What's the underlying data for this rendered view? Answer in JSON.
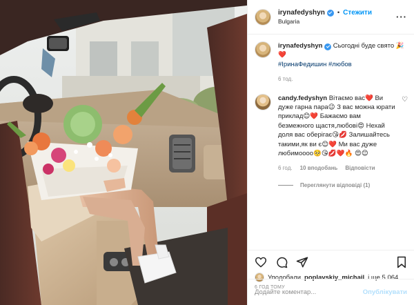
{
  "post_header": {
    "username": "irynafedyshyn",
    "separator": "•",
    "follow_label": "Стежити",
    "location": "Bulgaria"
  },
  "caption": {
    "username": "irynafedyshyn",
    "text": "Сьогодні буде свято 🎉❤️",
    "hashtags": "#ІринаФедишин #любов",
    "time": "6 тод."
  },
  "comment": {
    "username": "candy.fedyshyn",
    "text": "Вітаємо вас❤️ Ви дуже гарна пара😉 З вас можна юрати приклад😊❤️ Бажаємо вам безмежного щастя,любові😍 Нехай доля вас оберігає😘💋 Залишайтесь такими,як ви є😊❤️ Ми вас дуже любимоооо🥺😘💋❤️🔥 😍😊",
    "time": "6 год.",
    "likes": "10 вподобань",
    "reply_label": "Відповісти",
    "view_replies": "Переглянути відповіді (1)"
  },
  "actions": {
    "liked_by_prefix": "Уподобали",
    "liked_by_user": "poplavskiy_michail",
    "liked_by_suffix": "і ще 5 064",
    "time_ago": "6 ГОД ТОМУ"
  },
  "add_comment": {
    "placeholder": "Додайте коментар...",
    "publish_label": "Опублікувати"
  },
  "colors": {
    "link_blue": "#0095f6",
    "hashtag": "#00376b",
    "muted": "#8e8e8e",
    "publish_disabled": "#b2dffc"
  }
}
